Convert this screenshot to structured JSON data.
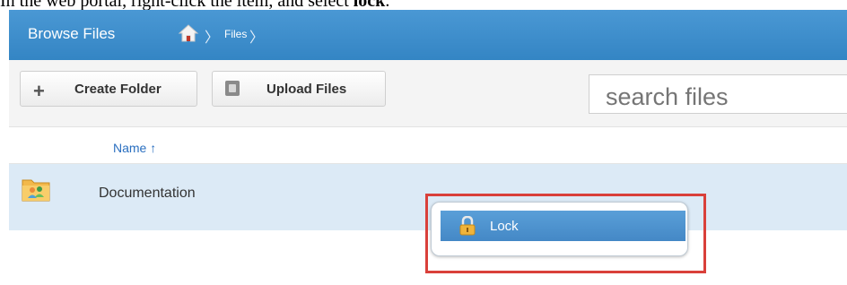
{
  "caption": {
    "prefix": "In the web portal, right-click the item, and select ",
    "bold": "lock",
    "suffix": "."
  },
  "header": {
    "title": "Browse Files",
    "separator": "〉",
    "breadcrumb_files": "Files",
    "home_icon": "home-icon"
  },
  "toolbar": {
    "create_folder_label": "Create Folder",
    "upload_files_label": "Upload Files",
    "search_placeholder": "search files"
  },
  "list": {
    "column_name": "Name ↑",
    "rows": [
      {
        "name": "Documentation",
        "icon": "shared-folder-icon"
      }
    ]
  },
  "context_menu": {
    "items": [
      {
        "label": "Lock",
        "icon": "lock-icon"
      }
    ]
  },
  "colors": {
    "header_bg": "#3e8fcd",
    "selected_row_bg": "#dceaf6",
    "menu_highlight": "#4f95cf",
    "annotation_border": "#d9403a"
  }
}
